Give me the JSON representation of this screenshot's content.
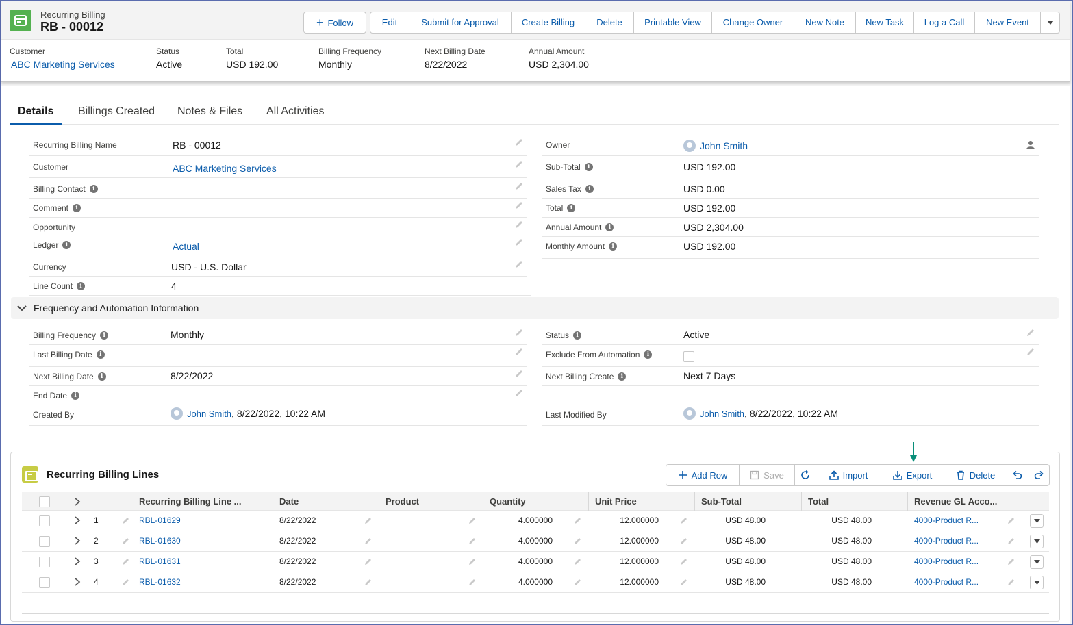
{
  "header": {
    "object_type": "Recurring Billing",
    "record_name": "RB - 00012",
    "follow_label": "Follow",
    "actions": [
      "Edit",
      "Submit for Approval",
      "Create Billing",
      "Delete",
      "Printable View",
      "Change Owner",
      "New Note",
      "New Task",
      "Log a Call",
      "New Event"
    ],
    "highlights": [
      {
        "label": "Customer",
        "value": "ABC Marketing Services"
      },
      {
        "label": "Status",
        "value": "Active"
      },
      {
        "label": "Total",
        "value": "USD 192.00"
      },
      {
        "label": "Billing Frequency",
        "value": "Monthly"
      },
      {
        "label": "Next Billing Date",
        "value": "8/22/2022"
      },
      {
        "label": "Annual Amount",
        "value": "USD 2,304.00"
      }
    ]
  },
  "tabs": [
    "Details",
    "Billings Created",
    "Notes & Files",
    "All Activities"
  ],
  "details": {
    "left": [
      {
        "label": "Recurring Billing Name",
        "value": "RB - 00012"
      },
      {
        "label": "Customer",
        "value": "ABC Marketing Services"
      },
      {
        "label": "Billing Contact",
        "value": ""
      },
      {
        "label": "Comment",
        "value": ""
      },
      {
        "label": "Opportunity",
        "value": ""
      },
      {
        "label": "Ledger",
        "value": "Actual"
      },
      {
        "label": "Currency",
        "value": "USD - U.S. Dollar"
      },
      {
        "label": "Line Count",
        "value": "4"
      }
    ],
    "right": [
      {
        "label": "Owner",
        "value": "John Smith"
      },
      {
        "label": "Sub-Total",
        "value": "USD 192.00"
      },
      {
        "label": "Sales Tax",
        "value": "USD 0.00"
      },
      {
        "label": "Total",
        "value": "USD 192.00"
      },
      {
        "label": "Annual Amount",
        "value": "USD 2,304.00"
      },
      {
        "label": "Monthly Amount",
        "value": "USD 192.00"
      }
    ]
  },
  "section": {
    "title": "Frequency and Automation Information",
    "left": [
      {
        "label": "Billing Frequency",
        "value": "Monthly"
      },
      {
        "label": "Last Billing Date",
        "value": ""
      },
      {
        "label": "Next Billing Date",
        "value": "8/22/2022"
      },
      {
        "label": "End Date",
        "value": ""
      },
      {
        "label": "Created By",
        "user": "John Smith",
        "value": ", 8/22/2022, 10:22 AM"
      }
    ],
    "right": [
      {
        "label": "Status",
        "value": "Active"
      },
      {
        "label": "Exclude From Automation",
        "value": ""
      },
      {
        "label": "Next Billing Create",
        "value": "Next 7 Days"
      },
      {
        "label": "Last Modified By",
        "user": "John Smith",
        "value": ", 8/22/2022, 10:22 AM"
      }
    ]
  },
  "lines": {
    "title": "Recurring Billing Lines",
    "buttons": {
      "add_row": "Add Row",
      "save": "Save",
      "import": "Import",
      "export": "Export",
      "delete": "Delete"
    },
    "columns": [
      "Recurring Billing Line ...",
      "Date",
      "Product",
      "Quantity",
      "Unit Price",
      "Sub-Total",
      "Total",
      "Revenue GL Acco..."
    ],
    "rows": [
      {
        "num": "1",
        "name": "RBL-01629",
        "date": "8/22/2022",
        "product": "",
        "quantity": "4.000000",
        "unit_price": "12.000000",
        "subtotal": "USD 48.00",
        "total": "USD 48.00",
        "gl": "4000-Product R..."
      },
      {
        "num": "2",
        "name": "RBL-01630",
        "date": "8/22/2022",
        "product": "",
        "quantity": "4.000000",
        "unit_price": "12.000000",
        "subtotal": "USD 48.00",
        "total": "USD 48.00",
        "gl": "4000-Product R..."
      },
      {
        "num": "3",
        "name": "RBL-01631",
        "date": "8/22/2022",
        "product": "",
        "quantity": "4.000000",
        "unit_price": "12.000000",
        "subtotal": "USD 48.00",
        "total": "USD 48.00",
        "gl": "4000-Product R..."
      },
      {
        "num": "4",
        "name": "RBL-01632",
        "date": "8/22/2022",
        "product": "",
        "quantity": "4.000000",
        "unit_price": "12.000000",
        "subtotal": "USD 48.00",
        "total": "USD 48.00",
        "gl": "4000-Product R..."
      }
    ]
  },
  "colors": {
    "brand_link": "#0b5cab",
    "object_icon": "#54b150",
    "related_icon": "#c7cc45",
    "export_arrow": "#0a8f7a"
  }
}
